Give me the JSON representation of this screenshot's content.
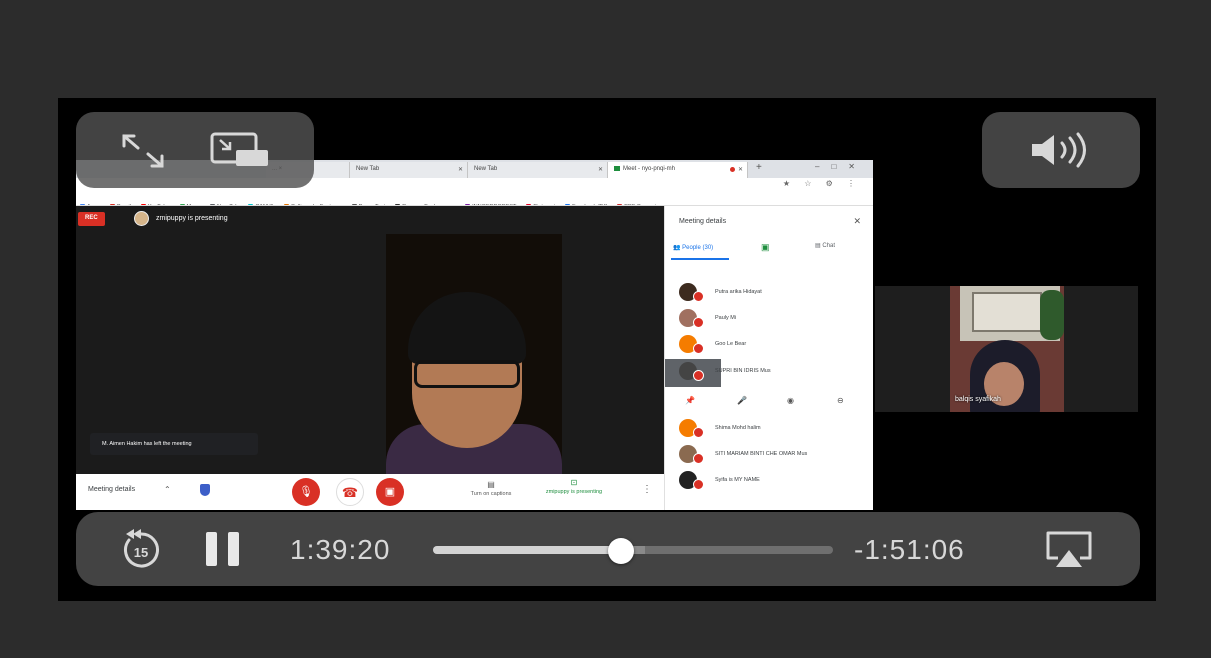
{
  "browser": {
    "tabs": [
      {
        "label": "... ×",
        "active": false
      },
      {
        "label": "New Tab",
        "active": false
      },
      {
        "label": "New Tab",
        "active": false
      },
      {
        "label": "Meet - nyo-pnqi-mh",
        "active": true
      }
    ],
    "bookmarks": [
      {
        "label": "Apps",
        "color": "#4285f4"
      },
      {
        "label": "Gmail",
        "color": "#d93025"
      },
      {
        "label": "YouTube",
        "color": "#ff0000"
      },
      {
        "label": "Maps",
        "color": "#34a853"
      },
      {
        "label": "New Tab",
        "color": "#5f6368"
      },
      {
        "label": "CANVA",
        "color": "#00c4cc"
      },
      {
        "label": "Calligraphy Fonts -...",
        "color": "#e37400"
      },
      {
        "label": "DreamTest",
        "color": "#555555"
      },
      {
        "label": "Remove Backgroun...",
        "color": "#333333"
      },
      {
        "label": "INNGERROREST",
        "color": "#7b1fa2"
      },
      {
        "label": "Pinterest",
        "color": "#e60023"
      },
      {
        "label": "Facebook ZMI",
        "color": "#1877f2"
      },
      {
        "label": "PDF Converter",
        "color": "#d32f2f"
      }
    ]
  },
  "meet": {
    "rec_label": "REC",
    "presenting_text": "zmipuppy is presenting",
    "toast_text": "M. Aimen Hakim has left the meeting",
    "meeting_details_label": "Meeting details",
    "captions_label": "Turn on captions",
    "present_label": "zmipuppy is presenting"
  },
  "panel": {
    "title": "Meeting details",
    "tab_people": "People (30)",
    "tab_chat": "Chat",
    "people": [
      {
        "name": "Putra arika Hidayat",
        "color": "#3d2b1f"
      },
      {
        "name": "Pauly Mi",
        "color": "#a07060"
      },
      {
        "name": "Goo Le Bear",
        "color": "#f57c00"
      },
      {
        "name": "SUPRI BIN IDRIS Mus",
        "color": "#444444"
      },
      {
        "name": "Shima Mohd halim",
        "color": "#f57c00"
      },
      {
        "name": "SITI MARIAM BINTI CHE OMAR Mus",
        "color": "#8a6a50"
      },
      {
        "name": "Syifa is MY NAME",
        "color": "#222222"
      }
    ]
  },
  "tile": {
    "name": "balqis syafikah"
  },
  "player": {
    "elapsed": "1:39:20",
    "remaining": "-1:51:06",
    "skip_back_seconds": "15",
    "progress": 0.47,
    "buffered": 0.53
  }
}
